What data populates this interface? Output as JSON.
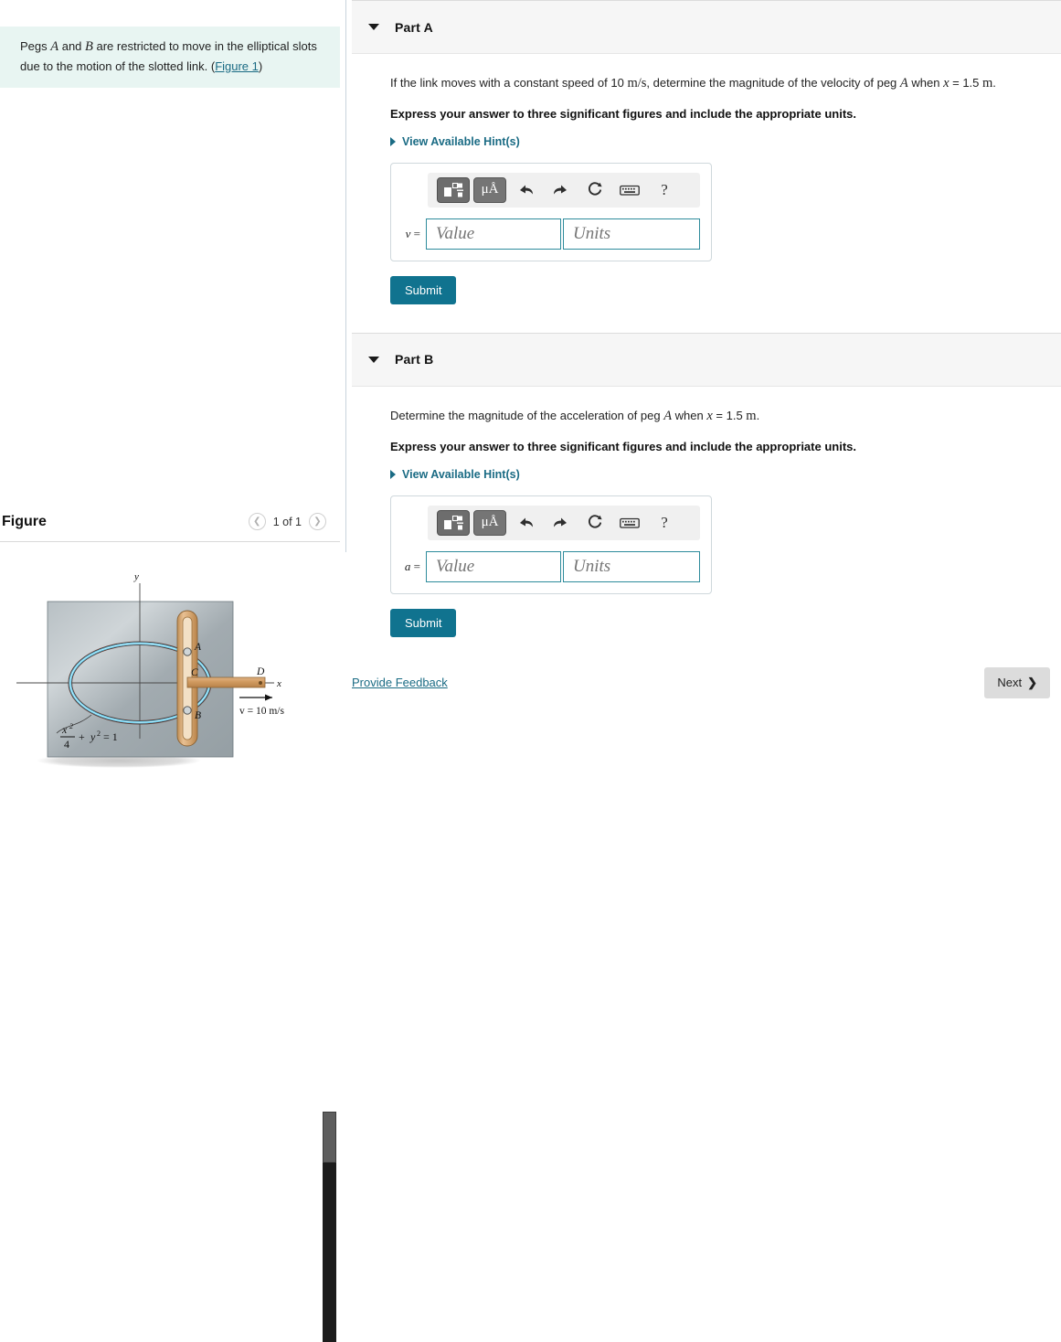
{
  "problem": {
    "text_before_a": "Pegs ",
    "var_a": "A",
    "text_mid": " and ",
    "var_b": "B",
    "text_after": " are restricted to move in the elliptical slots due to the motion of the slotted link. (",
    "figure_link": "Figure 1",
    "text_end": ")"
  },
  "figure_panel": {
    "title": "Figure",
    "count_label": "1 of 1",
    "prev_icon": "chevron-left-icon",
    "next_icon": "chevron-right-icon",
    "diagram": {
      "axis_y_label": "y",
      "axis_x_label": "x",
      "peg_a_label": "A",
      "peg_b_label": "B",
      "point_c_label": "C",
      "point_d_label": "D",
      "velocity_label": "v = 10 m/s",
      "ellipse_equation_num": "x",
      "ellipse_equation": "x²/4 + y² = 1",
      "plate_color": "#9aa3a8",
      "slot_color": "#4ec3e8",
      "link_color": "#d6a36a"
    }
  },
  "parts": [
    {
      "id": "part-a",
      "title": "Part A",
      "caret_icon": "caret-down-icon",
      "question_pre": "If the link moves with a constant speed of 10 ",
      "question_unit": "m/s",
      "question_mid": ", determine the magnitude of the velocity of peg ",
      "question_var": "A",
      "question_when": " when ",
      "question_x": "x",
      "question_eq": " = 1.5 ",
      "question_m": "m",
      "question_end": ".",
      "instruction": "Express your answer to three significant figures and include the appropriate units.",
      "hints_label": "View Available Hint(s)",
      "answer_symbol": "v",
      "answer_symbol_eq": "=",
      "value_placeholder": "Value",
      "units_placeholder": "Units",
      "value_current": "",
      "units_current": "",
      "submit_label": "Submit"
    },
    {
      "id": "part-b",
      "title": "Part B",
      "caret_icon": "caret-down-icon",
      "question_pre": "Determine the magnitude of the acceleration of peg ",
      "question_unit": "",
      "question_mid": "",
      "question_var": "A",
      "question_when": " when ",
      "question_x": "x",
      "question_eq": " = 1.5 ",
      "question_m": "m",
      "question_end": ".",
      "instruction": "Express your answer to three significant figures and include the appropriate units.",
      "hints_label": "View Available Hint(s)",
      "answer_symbol": "a",
      "answer_symbol_eq": "=",
      "value_placeholder": "Value",
      "units_placeholder": "Units",
      "value_current": "",
      "units_current": "",
      "submit_label": "Submit"
    }
  ],
  "toolbar": {
    "template_icon": "math-template-icon",
    "units_icon_label": "μÅ",
    "undo_icon": "undo-arrow-icon",
    "redo_icon": "redo-arrow-icon",
    "reset_icon": "reset-circular-arrow-icon",
    "keyboard_icon": "keyboard-icon",
    "help_label": "?"
  },
  "footer": {
    "feedback_label": "Provide Feedback",
    "next_label": "Next",
    "next_chevron": "chevron-right-icon"
  },
  "colors": {
    "accent_teal": "#10738f",
    "link_teal": "#1a6b84",
    "statement_bg": "#e8f5f2",
    "input_border": "#2e8b9c"
  }
}
